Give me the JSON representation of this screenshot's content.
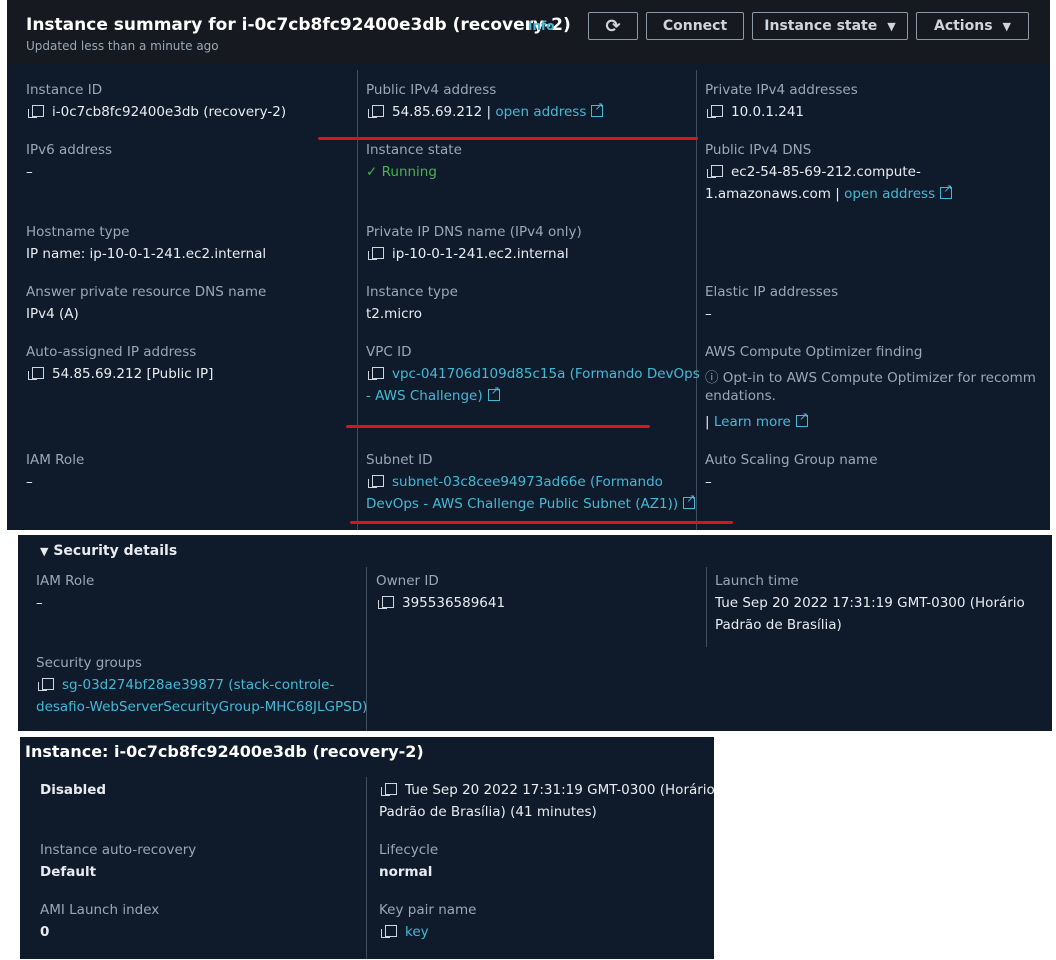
{
  "header": {
    "title": "Instance summary for i-0c7cb8fc92400e3db (recovery-2)",
    "info": "Info",
    "updated": "Updated less than a minute ago",
    "refresh_icon": "refresh-icon",
    "connect": "Connect",
    "instance_state": "Instance state",
    "actions": "Actions"
  },
  "summary": {
    "instance_id": {
      "label": "Instance ID",
      "value": "i-0c7cb8fc92400e3db (recovery-2)"
    },
    "public_ipv4": {
      "label": "Public IPv4 address",
      "value": "54.85.69.212",
      "sep": "|",
      "link": "open address"
    },
    "private_ipv4": {
      "label": "Private IPv4 addresses",
      "value": "10.0.1.241"
    },
    "ipv6": {
      "label": "IPv6 address",
      "value": "–"
    },
    "instance_state": {
      "label": "Instance state",
      "value": "Running"
    },
    "public_dns": {
      "label": "Public IPv4 DNS",
      "value_line1": "ec2-54-85-69-212.compute-",
      "value_line2": "1.amazonaws.com |",
      "link": "open address"
    },
    "hostname_type": {
      "label": "Hostname type",
      "value": "IP name: ip-10-0-1-241.ec2.internal"
    },
    "private_dns": {
      "label": "Private IP DNS name (IPv4 only)",
      "value": "ip-10-0-1-241.ec2.internal"
    },
    "answer_dns": {
      "label": "Answer private resource DNS name",
      "value": "IPv4 (A)"
    },
    "instance_type": {
      "label": "Instance type",
      "value": "t2.micro"
    },
    "elastic_ip": {
      "label": "Elastic IP addresses",
      "value": "–"
    },
    "auto_ip": {
      "label": "Auto-assigned IP address",
      "value": "54.85.69.212 [Public IP]"
    },
    "vpc_id": {
      "label": "VPC ID",
      "line1": "vpc-041706d109d85c15a (Formando DevOps",
      "line2": "- AWS Challenge)"
    },
    "optimizer": {
      "label": "AWS Compute Optimizer finding",
      "line1": "Opt-in to AWS Compute Optimizer for recomm",
      "line2": "endations.",
      "sep": "|",
      "link": "Learn more"
    },
    "iam_role": {
      "label": "IAM Role",
      "value": "–"
    },
    "subnet_id": {
      "label": "Subnet ID",
      "line1": "subnet-03c8cee94973ad66e (Formando",
      "line2": "DevOps - AWS Challenge Public Subnet (AZ1))"
    },
    "asg": {
      "label": "Auto Scaling Group name",
      "value": "–"
    }
  },
  "security": {
    "title": "Security details",
    "iam_role": {
      "label": "IAM Role",
      "value": "–"
    },
    "owner_id": {
      "label": "Owner ID",
      "value": "395536589641"
    },
    "launch_time": {
      "label": "Launch time",
      "line1": "Tue Sep 20 2022 17:31:19 GMT-0300 (Horário",
      "line2": "Padrão de Brasília)"
    },
    "security_groups": {
      "label": "Security groups",
      "line1": "sg-03d274bf28ae39877 (stack-controle-",
      "line2": "desafio-WebServerSecurityGroup-MHC68JLGPSD)"
    }
  },
  "instance": {
    "title": "Instance: i-0c7cb8fc92400e3db (recovery-2)",
    "disabled": "Disabled",
    "time_line1": "Tue Sep 20 2022 17:31:19 GMT-0300 (Horário",
    "time_line2": "Padrão de Brasília) (41 minutes)",
    "auto_recovery": {
      "label": "Instance auto-recovery",
      "value": "Default"
    },
    "lifecycle": {
      "label": "Lifecycle",
      "value": "normal"
    },
    "ami_index": {
      "label": "AMI Launch index",
      "value": "0"
    },
    "key_pair": {
      "label": "Key pair name",
      "value": "key"
    }
  }
}
